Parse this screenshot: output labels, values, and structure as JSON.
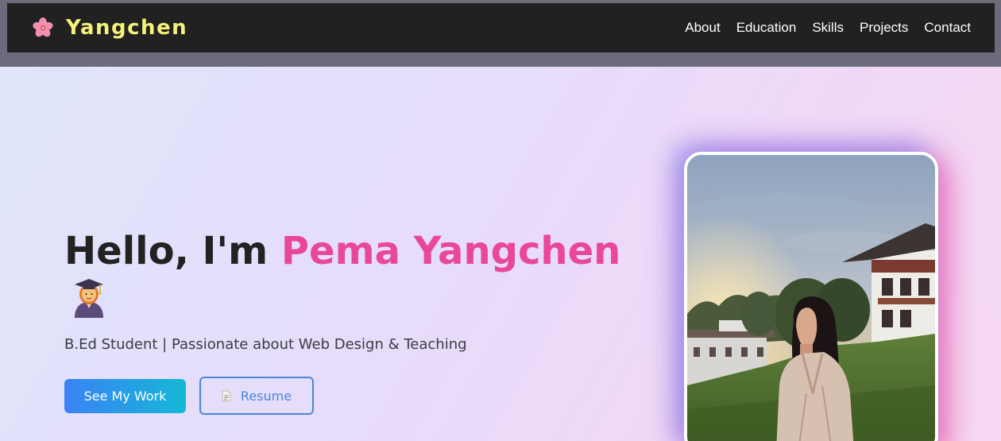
{
  "navbar": {
    "logo_icon": "cherry-blossom-icon",
    "logo_text": "Yangchen",
    "links": [
      {
        "label": "About"
      },
      {
        "label": "Education"
      },
      {
        "label": "Skills"
      },
      {
        "label": "Projects"
      },
      {
        "label": "Contact"
      }
    ]
  },
  "hero": {
    "greeting": "Hello, I'm ",
    "name": "Pema Yangchen",
    "greeting_icon": "student-emoji-icon",
    "tagline": "B.Ed Student | Passionate about Web Design & Teaching",
    "primary_button": "See My Work",
    "secondary_button": "Resume",
    "secondary_button_icon": "document-icon",
    "photo_icon": "profile-photo"
  },
  "colors": {
    "navbar_bg": "#212121",
    "logo_text": "#f5f27a",
    "name_accent": "#e8479a",
    "button_gradient_start": "#3b82f6",
    "button_gradient_end": "#14b8d6",
    "outline_button": "#4a86d9"
  }
}
